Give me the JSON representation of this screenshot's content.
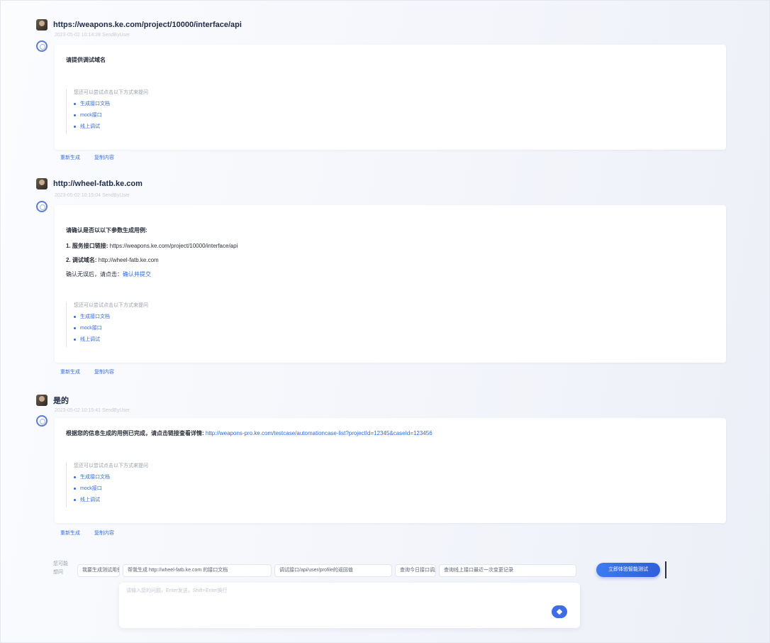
{
  "conversation": [
    {
      "user_text": "https://weapons.ke.com/project/10000/interface/api",
      "timestamp": "2023-05-02 10:14:28 SendByUser",
      "answer_lines": [
        {
          "text": "请提供调试域名",
          "bold": true
        }
      ],
      "hint_title": "您还可以尝试点击以下方式来提问",
      "hints": [
        "生成接口文档",
        "mock接口",
        "线上调试"
      ],
      "actions": [
        "重新生成",
        "复制内容"
      ]
    },
    {
      "user_text": "http://wheel-fatb.ke.com",
      "timestamp": "2023-05-02 10:15:04 SendByUser",
      "answer_lines": [
        {
          "text": "请确认是否以以下参数生成用例:",
          "bold": true
        },
        {
          "label": "1. 服务接口链接:",
          "text": " https://weapons.ke.com/project/10000/interface/api"
        },
        {
          "label": "2. 调试域名:",
          "text": " http://wheel-fatb.ke.com"
        },
        {
          "text": "确认无误后，请点击：",
          "link": "确认并提交"
        }
      ],
      "hint_title": "您还可以尝试点击以下方式来提问",
      "hints": [
        "生成接口文档",
        "mock接口",
        "线上调试"
      ],
      "actions": [
        "重新生成",
        "复制内容"
      ]
    },
    {
      "user_text": "是的",
      "timestamp": "2023-05-02 10:15:41 SendByUser",
      "answer_lines": [
        {
          "text": "根据您的信息生成的用例已完成，请点击链接查看详情: ",
          "bold": true,
          "link": "http://weapons-pro.ke.com/testcase/automationcase-list?projectId=12345&caseId=123456"
        }
      ],
      "hint_title": "您还可以尝试点击以下方式来提问",
      "hints": [
        "生成接口文档",
        "mock接口",
        "线上调试"
      ],
      "actions": [
        "重新生成",
        "复制内容"
      ]
    }
  ],
  "suggest": {
    "label": "您可能想问",
    "chips": [
      "我要生成测试用例",
      "帮我生成 http://wheel-fatb.ke.com 的接口文档",
      "调试接口/api/user/profile的返回值",
      "查询今日接口调用量",
      "查询线上接口最近一次变更记录"
    ],
    "primary_button": "立即体验智能测试"
  },
  "composer": {
    "placeholder": "请输入您的问题，Enter发送，Shift+Enter换行"
  },
  "colors": {
    "accent": "#2f6bdc",
    "primary": "#3d6ee6"
  }
}
